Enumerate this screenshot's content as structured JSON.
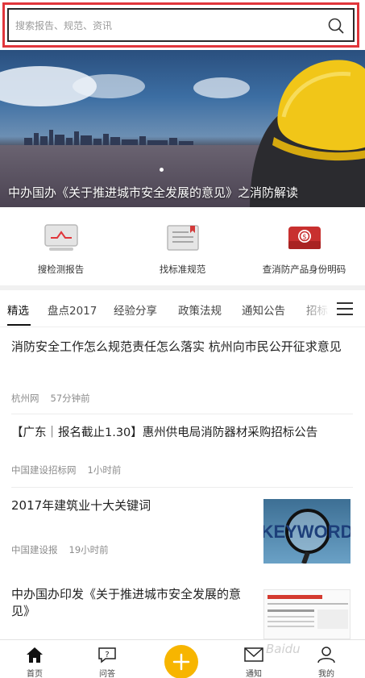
{
  "search": {
    "placeholder": "搜索报告、规范、资讯",
    "icon": "search-icon"
  },
  "banner": {
    "title": "中办国办《关于推进城市安全发展的意见》之消防解读"
  },
  "quick_links": [
    {
      "label": "搜检测报告",
      "icon": "monitor-report-icon"
    },
    {
      "label": "找标准规范",
      "icon": "document-standard-icon"
    },
    {
      "label": "查消防产品身份明码",
      "icon": "product-id-icon"
    }
  ],
  "tabs": [
    {
      "label": "精选",
      "active": true
    },
    {
      "label": "盘点2017"
    },
    {
      "label": "经验分享"
    },
    {
      "label": "政策法规"
    },
    {
      "label": "通知公告"
    },
    {
      "label": "招标"
    }
  ],
  "articles": [
    {
      "title": "消防安全工作怎么规范责任怎么落实 杭州向市民公开征求意见",
      "source": "杭州网",
      "time": "57分钟前"
    },
    {
      "title": "【广东｜报名截止1.30】惠州供电局消防器材采购招标公告",
      "source": "中国建设招标网",
      "time": "1小时前"
    },
    {
      "title": "2017年建筑业十大关键词",
      "source": "中国建设报",
      "time": "19小时前",
      "thumb_text": "KEYWORD"
    },
    {
      "title": "中办国办印发《关于推进城市安全发展的意见》",
      "source": "",
      "time": ""
    }
  ],
  "bottom_nav": [
    {
      "label": "首页",
      "icon": "home-icon"
    },
    {
      "label": "问答",
      "icon": "question-chat-icon"
    },
    {
      "label": "",
      "icon": "plus-icon"
    },
    {
      "label": "通知",
      "icon": "mail-icon"
    },
    {
      "label": "我的",
      "icon": "user-icon"
    }
  ],
  "watermark": "Baidu",
  "colors": {
    "accent": "#f7b500",
    "highlight_border": "#e0363b"
  }
}
